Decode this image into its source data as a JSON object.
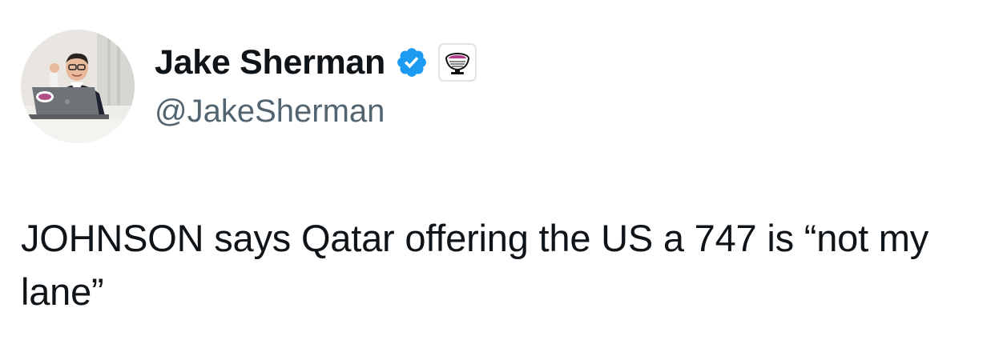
{
  "author": {
    "display_name": "Jake Sherman",
    "handle": "@JakeSherman",
    "verified": true,
    "verified_color": "#1d9bf0",
    "avatar_icon": "profile-photo",
    "affiliation_icon": "punchbowl-icon"
  },
  "tweet": {
    "text": "JOHNSON says Qatar offering the US a 747 is “not my lane”"
  },
  "colors": {
    "text_primary": "#0f1419",
    "text_secondary": "#536471",
    "background": "#ffffff"
  }
}
